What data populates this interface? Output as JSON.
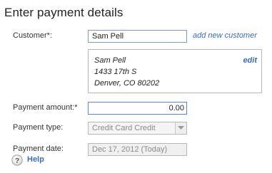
{
  "page": {
    "title": "Enter payment details"
  },
  "customer": {
    "label": "Customer*:",
    "value": "Sam Pell",
    "add_link": "add new customer"
  },
  "address": {
    "lines": [
      "Sam Pell",
      "1433 17th S",
      "Denver, CO 80202"
    ],
    "edit_link": "edit"
  },
  "payment_amount": {
    "label": "Payment amount:*",
    "value": "0.00"
  },
  "payment_type": {
    "label": "Payment type:",
    "selected": "Credit Card Credit",
    "icon": "chevron-down-icon"
  },
  "payment_date": {
    "label": "Payment date:",
    "value": "Dec 17, 2012 (Today)"
  },
  "help": {
    "label": "Help",
    "icon": "question-mark-icon"
  },
  "colors": {
    "link": "#3c6db5",
    "input_border": "#7f9db9",
    "disabled_bg": "#f0f0f0",
    "disabled_text": "#8c8c8c"
  }
}
